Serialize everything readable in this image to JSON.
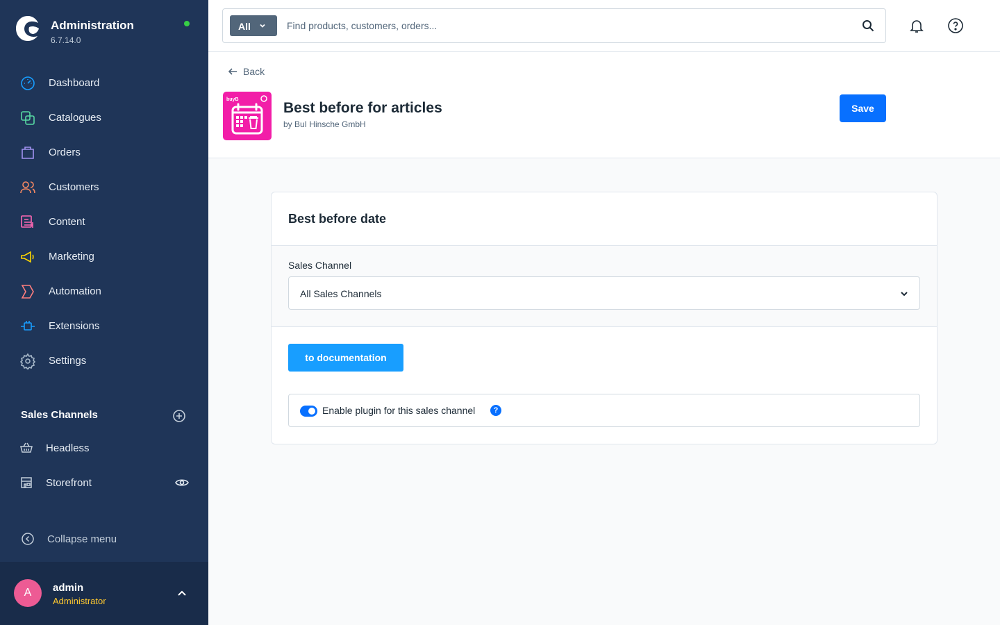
{
  "app": {
    "title": "Administration",
    "version": "6.7.14.0",
    "status_color": "#37d046"
  },
  "sidebar": {
    "items": [
      {
        "label": "Dashboard",
        "icon": "gauge-icon",
        "color": "#189eff"
      },
      {
        "label": "Catalogues",
        "icon": "products-icon",
        "color": "#57d9a3"
      },
      {
        "label": "Orders",
        "icon": "shopping-bag-icon",
        "color": "#a092f0"
      },
      {
        "label": "Customers",
        "icon": "users-icon",
        "color": "#f88962"
      },
      {
        "label": "Content",
        "icon": "content-icon",
        "color": "#ff68b4"
      },
      {
        "label": "Marketing",
        "icon": "megaphone-icon",
        "color": "#ffd700"
      },
      {
        "label": "Automation",
        "icon": "flow-icon",
        "color": "#ff7e7e"
      },
      {
        "label": "Extensions",
        "icon": "plug-icon",
        "color": "#189eff"
      },
      {
        "label": "Settings",
        "icon": "gear-icon",
        "color": "#a7b8c9"
      }
    ],
    "sales_channels_title": "Sales Channels",
    "sales_channels": [
      {
        "label": "Headless",
        "icon": "basket-icon"
      },
      {
        "label": "Storefront",
        "icon": "storefront-icon"
      }
    ],
    "collapse_label": "Collapse menu"
  },
  "user": {
    "initial": "A",
    "name": "admin",
    "role": "Administrator"
  },
  "search": {
    "type_label": "All",
    "placeholder": "Find products, customers, orders..."
  },
  "header": {
    "back_label": "Back",
    "plugin_title": "Best before for articles",
    "plugin_author": "by BuI Hinsche GmbH",
    "save_label": "Save",
    "plugin_icon_brand": "buyB",
    "accent": "#0870ff"
  },
  "card": {
    "title": "Best before date",
    "channel_label": "Sales Channel",
    "channel_value": "All Sales Channels",
    "doc_button": "to documentation",
    "toggle_label": "Enable plugin for this sales channel",
    "toggle_on": true,
    "info_glyph": "?"
  }
}
